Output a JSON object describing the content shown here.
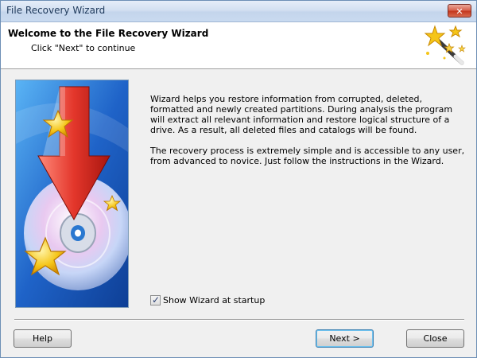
{
  "window": {
    "title": "File Recovery Wizard",
    "close_glyph": "✕"
  },
  "header": {
    "title": "Welcome to the File Recovery Wizard",
    "subtitle": "Click \"Next\" to continue",
    "icon": "magic-wand-icon"
  },
  "sidebar_image": {
    "icon": "disk-recovery-illustration"
  },
  "main": {
    "paragraph1": "Wizard helps you restore information from corrupted, deleted, formatted and newly created partitions. During analysis the program will extract all relevant information and restore logical structure of a drive. As a result, all deleted files and catalogs will be found.",
    "paragraph2": "The recovery process is extremely simple and is accessible to any user, from advanced to novice. Just follow the instructions in the Wizard."
  },
  "startup_checkbox": {
    "label": "Show Wizard at startup",
    "checked": true,
    "mark": "✓"
  },
  "buttons": {
    "help": "Help",
    "next": "Next >",
    "close": "Close"
  },
  "colors": {
    "titlebar": "#c9daf0",
    "close_button": "#c4381f",
    "image_bg": "#1f63c8",
    "arrow": "#e3362b",
    "star": "#f5c518"
  }
}
